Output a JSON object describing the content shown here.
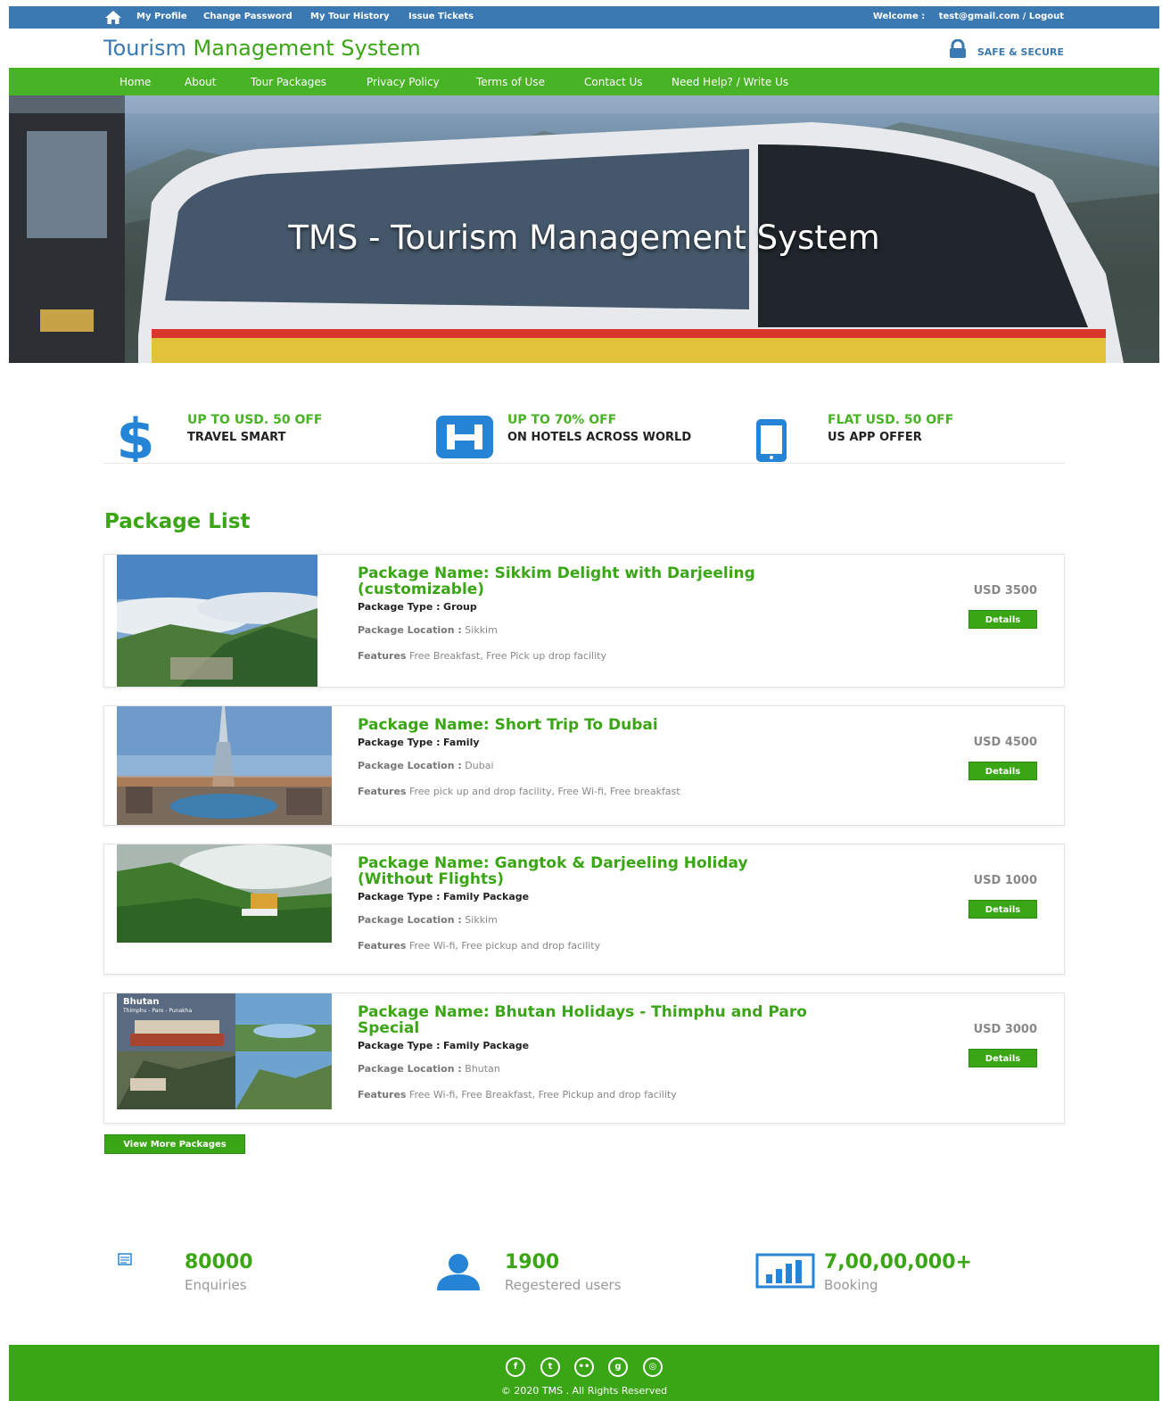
{
  "topbar": {
    "links": [
      "My Profile",
      "Change Password",
      "My Tour History",
      "Issue Tickets"
    ],
    "welcome_label": "Welcome :",
    "user_logout": "test@gmail.com / Logout"
  },
  "header": {
    "brand_part1": "Tourism",
    "brand_part2": "Management System",
    "secure_label": "SAFE & SECURE"
  },
  "nav": {
    "items": [
      "Home",
      "About",
      "Tour Packages",
      "Privacy Policy",
      "Terms of Use",
      "Contact Us",
      "Need Help? / Write Us"
    ]
  },
  "hero": {
    "title": "TMS - Tourism Management System"
  },
  "offers": [
    {
      "icon": "dollar-icon",
      "title": "UP TO USD. 50 OFF",
      "subtitle": "TRAVEL SMART"
    },
    {
      "icon": "hotel-icon",
      "title": "UP TO 70% OFF",
      "subtitle": "ON HOTELS ACROSS WORLD"
    },
    {
      "icon": "mobile-icon",
      "title": "FLAT USD. 50 OFF",
      "subtitle": "US APP OFFER"
    }
  ],
  "package_list": {
    "title": "Package List",
    "name_prefix": "Package Name:",
    "type_prefix": "Package Type :",
    "location_label": "Package Location :",
    "features_label": "Features",
    "details_label": "Details",
    "items": [
      {
        "name": "Sikkim Delight with Darjeeling (customizable)",
        "type": "Group",
        "location": "Sikkim",
        "features": "Free Breakfast, Free Pick up drop facility",
        "price": "USD 3500"
      },
      {
        "name": "Short Trip To Dubai",
        "type": "Family",
        "location": "Dubai",
        "features": "Free pick up and drop facility, Free Wi-fi, Free breakfast",
        "price": "USD 4500"
      },
      {
        "name": "Gangtok & Darjeeling Holiday (Without Flights)",
        "type": "Family Package",
        "location": "Sikkim",
        "features": "Free Wi-fi, Free pickup and drop facility",
        "price": "USD 1000"
      },
      {
        "name": "Bhutan Holidays - Thimphu and Paro Special",
        "type": "Family Package",
        "location": "Bhutan",
        "features": "Free Wi-fi, Free Breakfast, Free Pickup and drop facility",
        "price": "USD 3000",
        "image_caption": "Bhutan",
        "image_subcaption": "Thimphu - Paro - Punakha"
      }
    ],
    "view_more_label": "View More Packages"
  },
  "stats": [
    {
      "icon": "enquiry-icon",
      "value": "80000",
      "label": "Enquiries"
    },
    {
      "icon": "user-icon",
      "value": "1900",
      "label": "Regestered users"
    },
    {
      "icon": "bar-chart-icon",
      "value": "7,00,00,000+",
      "label": "Booking"
    }
  ],
  "footer": {
    "social": [
      "facebook-icon",
      "twitter-icon",
      "flickr-icon",
      "google-plus-icon",
      "dribbble-icon"
    ],
    "copyright": "© 2020 TMS . All Rights Reserved"
  },
  "colors": {
    "topbar_blue": "#3a79b2",
    "nav_green": "#48b324",
    "accent_green": "#3aa616"
  }
}
